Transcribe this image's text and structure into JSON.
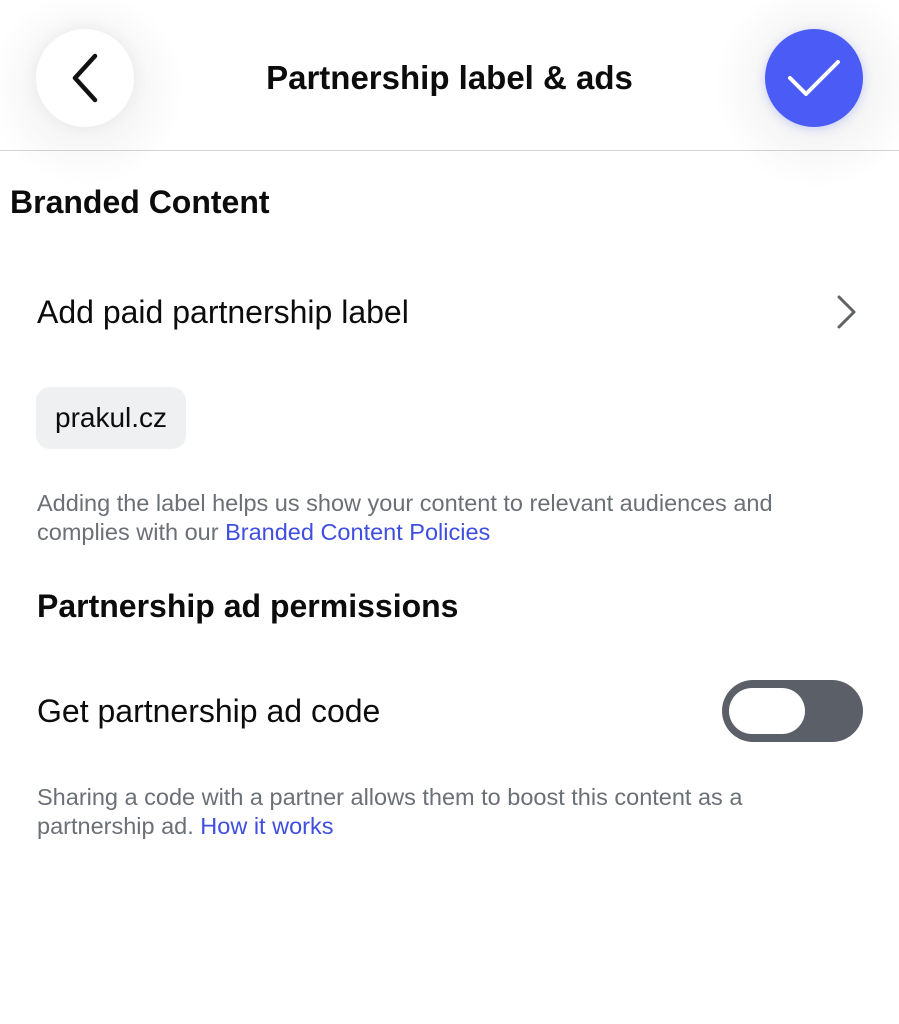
{
  "header": {
    "title": "Partnership label & ads",
    "back_icon": "chevron-left-icon",
    "confirm_icon": "checkmark-icon",
    "accent_color": "#4a5cf5"
  },
  "branded_content": {
    "heading": "Branded Content",
    "paid_partnership_label": "Add paid partnership label",
    "row_icon": "chevron-right-icon",
    "partner_chip": "prakul.cz",
    "helper_text": "Adding the label helps us show your content to relevant audiences and complies with our ",
    "helper_link": "Branded Content Policies"
  },
  "ad_permissions": {
    "heading": "Partnership ad permissions",
    "ad_code_label": "Get partnership ad code",
    "ad_code_toggle_on": false,
    "helper_text": "Sharing a code with a partner allows them to boost this content as a partnership ad. ",
    "helper_link": "How it works",
    "link_color": "#3f4ee0"
  }
}
